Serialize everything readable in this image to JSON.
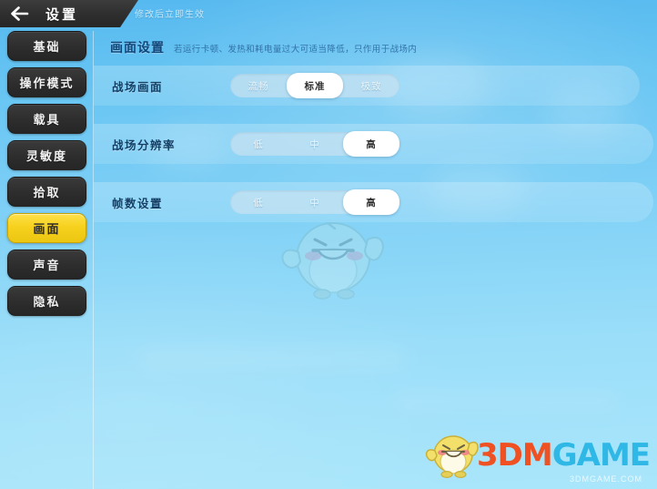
{
  "header": {
    "back_icon": "back-arrow-icon",
    "title": "设置",
    "hint": "修改后立即生效"
  },
  "sidebar": {
    "items": [
      {
        "label": "基础",
        "selected": false
      },
      {
        "label": "操作模式",
        "selected": false
      },
      {
        "label": "载具",
        "selected": false
      },
      {
        "label": "灵敏度",
        "selected": false
      },
      {
        "label": "拾取",
        "selected": false
      },
      {
        "label": "画面",
        "selected": true
      },
      {
        "label": "声音",
        "selected": false
      },
      {
        "label": "隐私",
        "selected": false
      }
    ]
  },
  "section": {
    "title": "画面设置",
    "description": "若运行卡顿、发热和耗电量过大可适当降低，只作用于战场内"
  },
  "settings": [
    {
      "label": "战场画面",
      "options": [
        "流畅",
        "标准",
        "极致"
      ],
      "selected_index": 1,
      "selected_value": "标准"
    },
    {
      "label": "战场分辨率",
      "options": [
        "低",
        "中",
        "高"
      ],
      "selected_index": 2,
      "selected_value": "高"
    },
    {
      "label": "帧数设置",
      "options": [
        "低",
        "中",
        "高"
      ],
      "selected_index": 2,
      "selected_value": "高"
    }
  ],
  "watermark": {
    "brand_part1": "3DM",
    "brand_part2": "GAME",
    "brand_sub": "3DMGAME.COM",
    "mascot_icon": "bird-mascot-icon",
    "brand_bird_icon": "yellow-bird-icon"
  },
  "colors": {
    "accent_yellow": "#f6d11d",
    "panel_dark": "#2c2c2c",
    "bg_blue": "#7fd0f6",
    "brand_orange": "#ef5122",
    "brand_cyan": "#2fb8e6",
    "selected_pill": "#ffffff"
  }
}
